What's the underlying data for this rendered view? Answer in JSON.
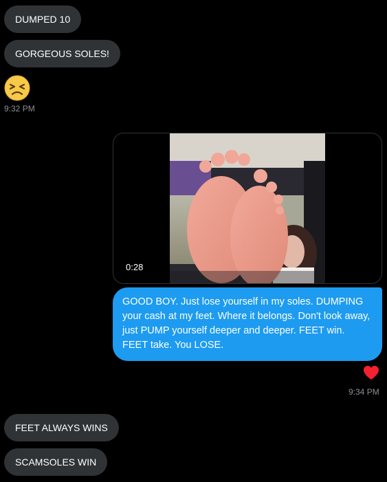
{
  "messages_top": [
    {
      "text": "DUMPED 10"
    },
    {
      "text": "GORGEOUS SOLES!"
    }
  ],
  "emoji": {
    "name": "persevering-face-icon",
    "color": "#f7c948"
  },
  "timestamp_1": "9:32 PM",
  "video": {
    "duration": "0:28"
  },
  "outgoing_message": "GOOD BOY. Just lose yourself in my soles. DUMPING your cash at my feet. Where it belongs. Don't look away, just PUMP yourself deeper and deeper. FEET win. FEET take. You LOSE.",
  "reaction": {
    "name": "heart-icon",
    "color": "#f4212e"
  },
  "timestamp_2": "9:34 PM",
  "messages_bottom": [
    {
      "text": "FEET ALWAYS WINS"
    },
    {
      "text": "SCAMSOLES WIN"
    }
  ],
  "colors": {
    "incoming_bubble": "#2f3336",
    "outgoing_bubble": "#1d9bf0",
    "background": "#000000",
    "timestamp": "#8b8f94"
  }
}
